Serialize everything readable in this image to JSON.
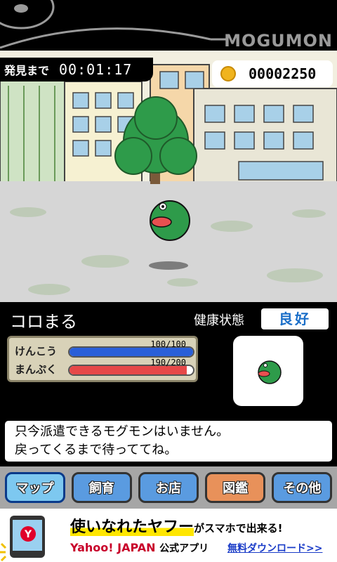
{
  "header": {
    "brand": "MOGUMON"
  },
  "hud": {
    "timer_label": "発見まで",
    "timer_value": "00:01:17",
    "coins": "00002250"
  },
  "pet": {
    "name": "コロまる",
    "health_label": "健康状態",
    "health_status": "良好",
    "gauges": [
      {
        "label": "けんこう",
        "value_text": "100/100",
        "fraction": 1.0,
        "color": "#2a5fd8"
      },
      {
        "label": "まんぷく",
        "value_text": "190/200",
        "fraction": 0.95,
        "color": "#e64848"
      }
    ]
  },
  "message": {
    "line1": "只今派遣できるモグモンはいません。",
    "line2": "戻ってくるまで待っててね。"
  },
  "menu": [
    {
      "label": "マップ",
      "color": "#7dc8f0",
      "selected": true
    },
    {
      "label": "飼育",
      "color": "#5a9be0",
      "selected": false
    },
    {
      "label": "お店",
      "color": "#5a9be0",
      "selected": false
    },
    {
      "label": "図鑑",
      "color": "#e8915a",
      "selected": false
    },
    {
      "label": "その他",
      "color": "#5a9be0",
      "selected": false
    }
  ],
  "ad": {
    "headline": "使いなれたヤフー",
    "headline_tail": "がスマホで出来る!",
    "brand": "Yahoo! JAPAN",
    "brand_tail": "公式アプリ",
    "link": "無料ダウンロード>>"
  },
  "colors": {
    "accent_blue": "#1a6ec8",
    "pet_green": "#2e9b4a"
  }
}
